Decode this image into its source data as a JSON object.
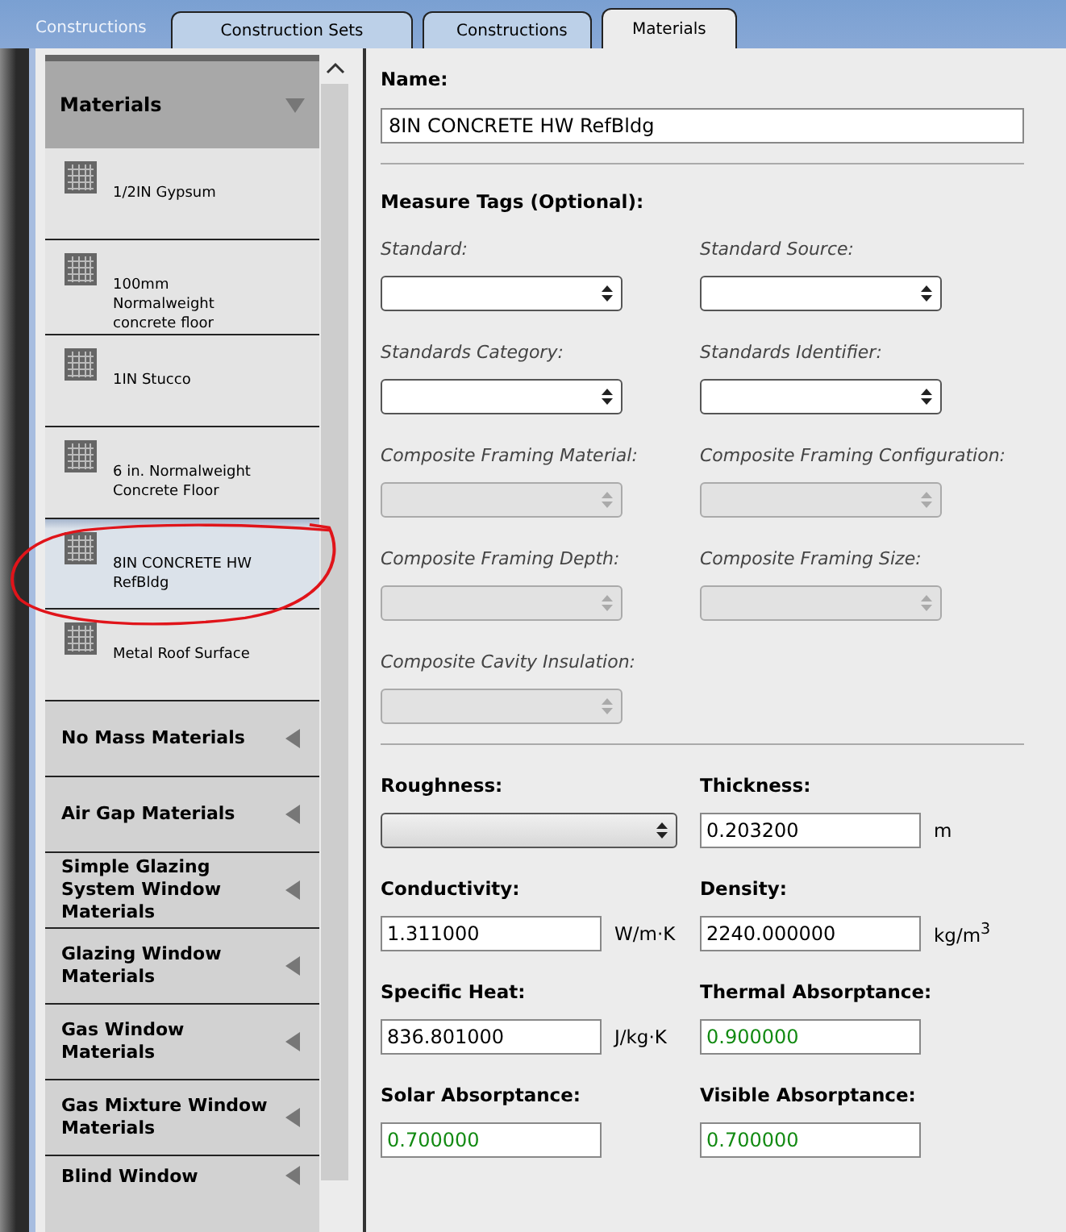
{
  "app_tab": {
    "label": "Constructions"
  },
  "tabs": [
    {
      "label": "Construction Sets",
      "selected": false
    },
    {
      "label": "Constructions",
      "selected": false
    },
    {
      "label": "Materials",
      "selected": true
    }
  ],
  "sidebar": {
    "header": {
      "label": "Materials",
      "expanded": true
    },
    "items": [
      {
        "label": "1/2IN Gypsum",
        "selected": false,
        "circled": false
      },
      {
        "label": "100mm Normalweight concrete floor",
        "selected": false,
        "circled": false
      },
      {
        "label": "1IN Stucco",
        "selected": false,
        "circled": false
      },
      {
        "label": "6 in. Normalweight Concrete Floor",
        "selected": false,
        "circled": false
      },
      {
        "label": "8IN CONCRETE HW RefBldg",
        "selected": true,
        "circled": true
      },
      {
        "label": "Metal Roof Surface",
        "selected": false,
        "circled": false
      }
    ],
    "categories": [
      {
        "label": "No Mass Materials",
        "expanded": false
      },
      {
        "label": "Air Gap Materials",
        "expanded": false
      },
      {
        "label": "Simple Glazing System Window Materials",
        "expanded": false
      },
      {
        "label": "Glazing Window Materials",
        "expanded": false
      },
      {
        "label": "Gas Window Materials",
        "expanded": false
      },
      {
        "label": "Gas Mixture Window Materials",
        "expanded": false
      },
      {
        "label": "Blind Window",
        "expanded": false
      }
    ]
  },
  "name": {
    "label": "Name:",
    "value": "8IN CONCRETE HW RefBldg"
  },
  "measure_tags": {
    "title": "Measure Tags (Optional):",
    "fields": [
      {
        "label": "Standard:",
        "disabled": false
      },
      {
        "label": "Standard Source:",
        "disabled": false
      },
      {
        "label": "Standards Category:",
        "disabled": false
      },
      {
        "label": "Standards Identifier:",
        "disabled": false
      },
      {
        "label": "Composite Framing Material:",
        "disabled": true
      },
      {
        "label": "Composite Framing Configuration:",
        "disabled": true
      },
      {
        "label": "Composite Framing Depth:",
        "disabled": true
      },
      {
        "label": "Composite Framing Size:",
        "disabled": true
      },
      {
        "label": "Composite Cavity Insulation:",
        "disabled": true
      }
    ]
  },
  "properties": [
    {
      "label": "Roughness:",
      "kind": "dropdown"
    },
    {
      "label": "Thickness:",
      "kind": "number",
      "value": "0.203200",
      "unit": "m",
      "defaulted": false
    },
    {
      "label": "Conductivity:",
      "kind": "number",
      "value": "1.311000",
      "unit": "W/m·K",
      "defaulted": false
    },
    {
      "label": "Density:",
      "kind": "number",
      "value": "2240.000000",
      "unit": "kg/m$^{3}$",
      "defaulted": false
    },
    {
      "label": "Specific Heat:",
      "kind": "number",
      "value": "836.801000",
      "unit": "J/kg·K",
      "defaulted": false
    },
    {
      "label": "Thermal Absorptance:",
      "kind": "number",
      "value": "0.900000",
      "defaulted": true
    },
    {
      "label": "Solar Absorptance:",
      "kind": "number",
      "value": "0.700000",
      "defaulted": true
    },
    {
      "label": "Visible Absorptance:",
      "kind": "number",
      "value": "0.700000",
      "defaulted": true
    }
  ]
}
